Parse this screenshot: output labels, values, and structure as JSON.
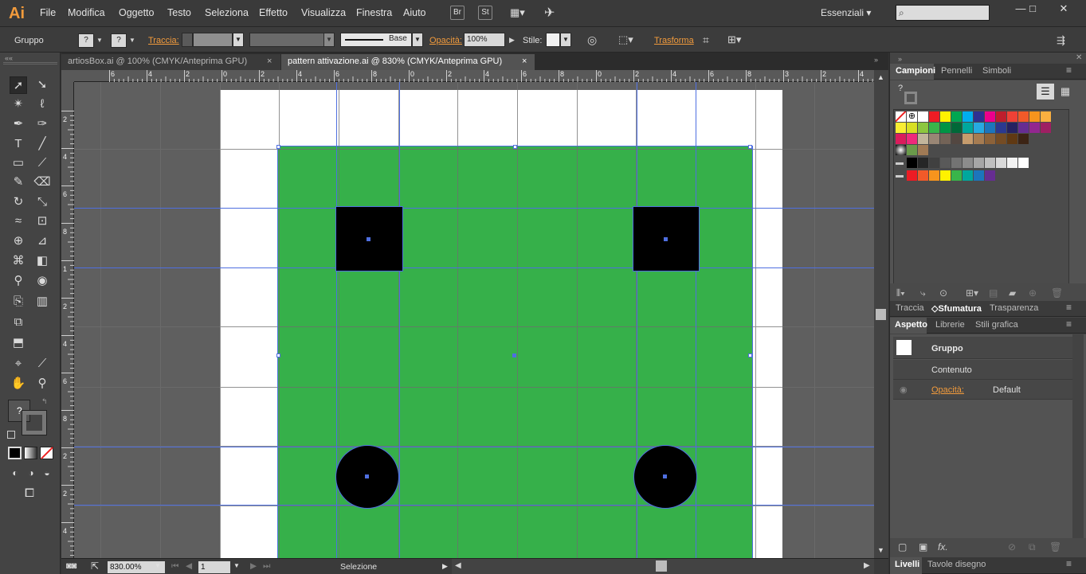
{
  "app": {
    "logo": "Ai",
    "menu": [
      "File",
      "Modifica",
      "Oggetto",
      "Testo",
      "Seleziona",
      "Effetto",
      "Visualizza",
      "Finestra",
      "Aiuto"
    ],
    "bridge": "Br",
    "stock": "St",
    "workspace": "Essenziali",
    "window_controls": [
      "minimize-icon",
      "maximize-icon",
      "close-icon"
    ]
  },
  "control": {
    "selection": "Gruppo",
    "fill_q": "?",
    "stroke_q": "?",
    "stroke_label": "Traccia:",
    "stroke_profile": "Base",
    "opacity_label": "Opacità:",
    "opacity_value": "100%",
    "style_label": "Stile:",
    "transform_label": "Trasforma"
  },
  "tabs": [
    {
      "label": "artiosBox.ai @ 100% (CMYK/Anteprima GPU)",
      "close": "×",
      "active": false
    },
    {
      "label": "pattern attivazione.ai @ 830% (CMYK/Anteprima GPU)",
      "close": "×",
      "active": true
    }
  ],
  "ruler": {
    "top_ticks": [
      "6",
      "4",
      "2",
      "0",
      "2",
      "4",
      "6",
      "8",
      "0",
      "2",
      "4",
      "6",
      "8",
      "0",
      "2",
      "4",
      "6",
      "8",
      "3",
      "2",
      "4"
    ],
    "left_ticks": [
      "2",
      "4",
      "6",
      "8",
      "1",
      "2",
      "4",
      "6",
      "8",
      "2",
      "2",
      "4"
    ]
  },
  "status": {
    "zoom": "830.00%",
    "artboard": "1",
    "tool": "Selezione"
  },
  "panels": {
    "top_tabs": [
      "Campioni",
      "Pennelli",
      "Simboli"
    ],
    "mid_tabs": [
      "Traccia",
      "Sfumatura",
      "Trasparenza"
    ],
    "appearance_tabs": [
      "Aspetto",
      "Librerie",
      "Stili grafica"
    ],
    "appearance_rows": {
      "group": "Gruppo",
      "content": "Contenuto",
      "opacity_label": "Opacità:",
      "opacity_value": "Default"
    },
    "bottom_tabs": [
      "Livelli",
      "Tavole disegno"
    ],
    "fx": "fx."
  },
  "colors": {
    "accent_orange": "#f29b3c",
    "artwork_green": "#36b04a",
    "guide_blue": "#4f6fe0",
    "swatches_row1": [
      "#ffffff",
      "#ed1c24",
      "#fff200",
      "#00a651",
      "#00aeef",
      "#2e3192",
      "#ec008c",
      "#be1e2d",
      "#ef4136",
      "#f15a29",
      "#f7941d",
      "#fbb040"
    ],
    "swatches_row2": [
      "#f9ed32",
      "#d7df23",
      "#8dc63f",
      "#39b54a",
      "#009444",
      "#006838",
      "#00a79d",
      "#27aae1",
      "#1c75bc",
      "#2b3990",
      "#262262",
      "#662d91",
      "#92278f",
      "#9e1f63"
    ],
    "swatches_row3": [
      "#da1c5c",
      "#ee2a7b",
      "#c2b59b",
      "#998675",
      "#736357",
      "#534741",
      "#c69c6d",
      "#a67c52",
      "#8c6239",
      "#754c24",
      "#603913",
      "#3c2415"
    ],
    "swatches_gray": [
      "#000000",
      "#262626",
      "#404040",
      "#595959",
      "#737373",
      "#8c8c8c",
      "#a6a6a6",
      "#bfbfbf",
      "#d9d9d9",
      "#f2f2f2",
      "#ffffff"
    ],
    "swatches_group": [
      "#ed1c24",
      "#f15a29",
      "#f7941d",
      "#fff200",
      "#39b54a",
      "#00a79d",
      "#1c75bc",
      "#662d91"
    ]
  }
}
